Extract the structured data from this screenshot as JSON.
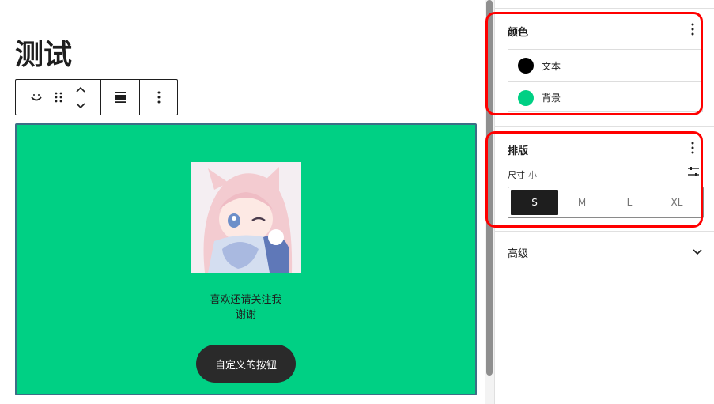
{
  "editor": {
    "page_title": "测试",
    "image_alt": "anime girl avatar",
    "caption_line1": "喜欢还请关注我",
    "caption_line2": "谢谢",
    "button_label": "自定义的按钮",
    "background_color": "#00d084",
    "button_color": "#2a2a2a"
  },
  "toolbar": {
    "icons": [
      "block-type-icon",
      "drag-handle-icon",
      "move-up-icon",
      "move-down-icon",
      "align-icon",
      "more-options-icon"
    ]
  },
  "sidebar": {
    "color_panel": {
      "title": "颜色",
      "items": [
        {
          "label": "文本",
          "swatch": "#000000"
        },
        {
          "label": "背景",
          "swatch": "#00d084"
        }
      ]
    },
    "typography_panel": {
      "title": "排版",
      "size_label": "尺寸",
      "size_value": "小",
      "sizes": [
        "S",
        "M",
        "L",
        "XL"
      ],
      "selected_size": "S"
    },
    "advanced_panel": {
      "title": "高级"
    }
  },
  "colors": {
    "highlight": "#ff0000",
    "accent": "#00d084"
  }
}
